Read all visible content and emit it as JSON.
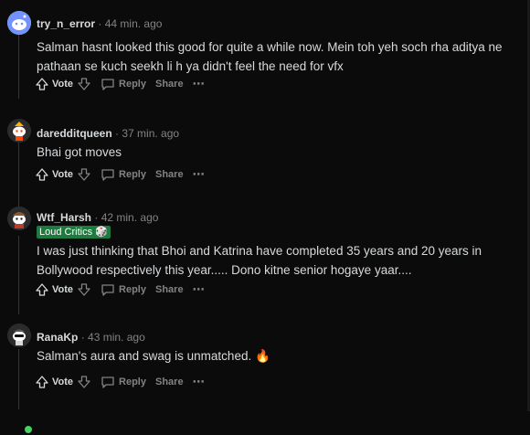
{
  "comments": [
    {
      "author": "try_n_error",
      "time": "44 min. ago",
      "flair": "",
      "text": "Salman hasnt looked this good for quite a while now. Mein toh yeh soch rha aditya ne pathaan se kuch seekh li h ya didn't feel the need for vfx",
      "vote_label": "Vote",
      "reply_label": "Reply",
      "share_label": "Share",
      "avatar_color": "#7193ff"
    },
    {
      "author": "daredditqueen",
      "time": "37 min. ago",
      "flair": "",
      "text": "Bhai got moves",
      "vote_label": "Vote",
      "reply_label": "Reply",
      "share_label": "Share",
      "avatar_color": "#ff4500"
    },
    {
      "author": "Wtf_Harsh",
      "time": "42 min. ago",
      "flair": "Loud Critics",
      "text": "I was just thinking that Bhoi and Katrina have completed 35 years and 20 years in Bollywood respectively this year..... Dono kitne senior hogaye yaar....",
      "vote_label": "Vote",
      "reply_label": "Reply",
      "share_label": "Share",
      "avatar_color": "#8b5a2b"
    },
    {
      "author": "RanaKp",
      "time": "43 min. ago",
      "flair": "",
      "text": "Salman's aura and swag is unmatched. 🔥",
      "vote_label": "Vote",
      "reply_label": "Reply",
      "share_label": "Share",
      "avatar_color": "#3a3a3a"
    }
  ],
  "separator": "·",
  "more_icon": "⋯",
  "colors": {
    "flair_bg": "#1f7a3f",
    "online": "#46d160",
    "background": "#0b0b0b"
  }
}
